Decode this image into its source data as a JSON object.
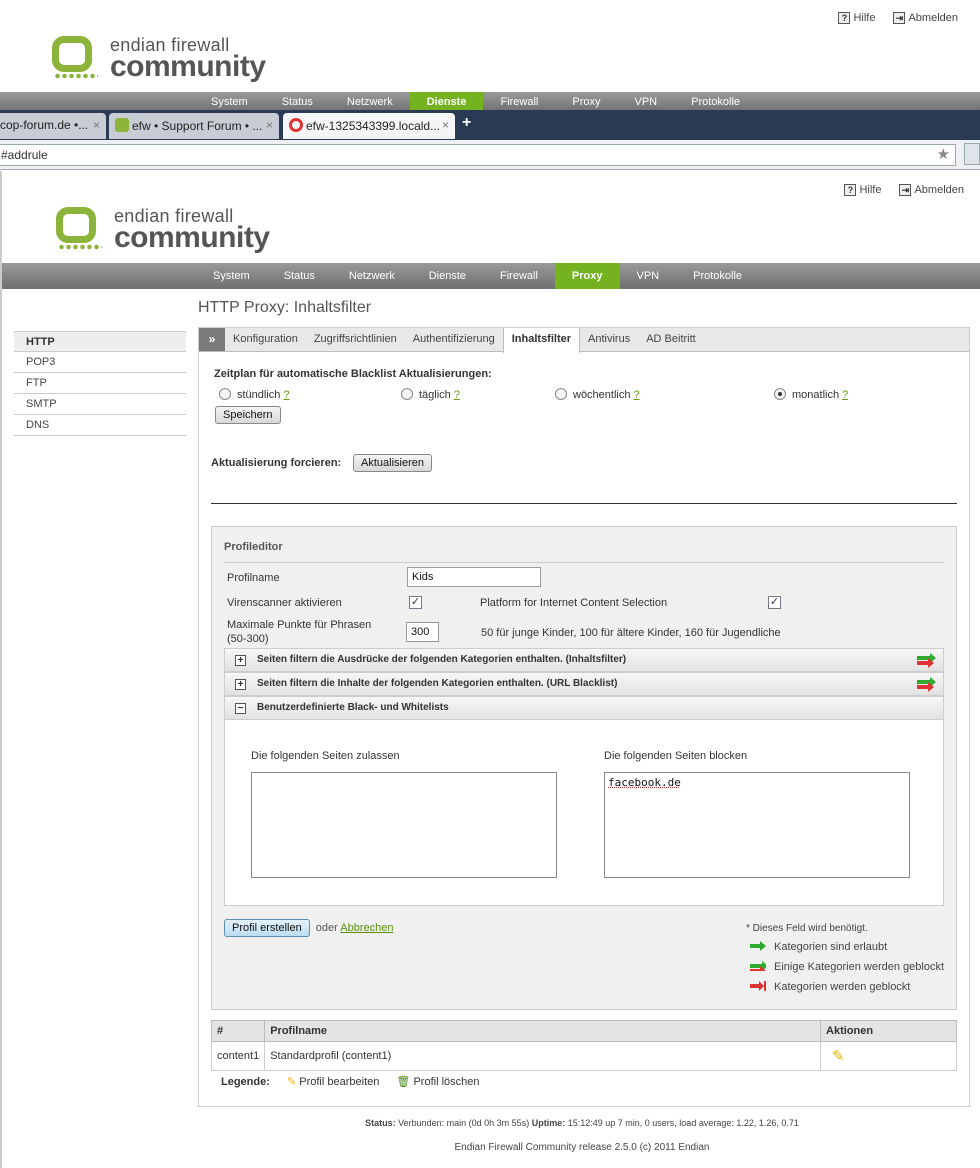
{
  "top_bg": {
    "help_label": "Hilfe",
    "logout_label": "Abmelden",
    "logo_line1": "endian firewall",
    "logo_line2": "community",
    "nav": [
      "System",
      "Status",
      "Netzwerk",
      "Dienste",
      "Firewall",
      "Proxy",
      "VPN",
      "Protokolle"
    ],
    "nav_active": "Dienste"
  },
  "browser": {
    "tabs": [
      {
        "title": "cop-forum.de •..."
      },
      {
        "title": "efw • Support Forum • ..."
      },
      {
        "title": "efw-1325343399.locald..."
      }
    ],
    "new_tab_label": "+",
    "url": "#addrule"
  },
  "header": {
    "help_label": "Hilfe",
    "logout_label": "Abmelden",
    "logo_line1": "endian firewall",
    "logo_line2": "community"
  },
  "nav": {
    "items": [
      "System",
      "Status",
      "Netzwerk",
      "Dienste",
      "Firewall",
      "Proxy",
      "VPN",
      "Protokolle"
    ],
    "active": "Proxy"
  },
  "sidebar": {
    "items": [
      "HTTP",
      "POP3",
      "FTP",
      "SMTP",
      "DNS"
    ],
    "active": "HTTP"
  },
  "page_title": "HTTP Proxy: Inhaltsfilter",
  "tabs": {
    "expander": "»",
    "items": [
      "Konfiguration",
      "Zugriffsrichtlinien",
      "Authentifizierung",
      "Inhaltsfilter",
      "Antivirus",
      "AD Beitritt"
    ],
    "active": "Inhaltsfilter"
  },
  "schedule": {
    "title": "Zeitplan für automatische Blacklist Aktualisierungen:",
    "options": [
      "stündlich",
      "täglich",
      "wöchentlich",
      "monatlich"
    ],
    "selected": "monatlich",
    "help_mark": "?",
    "save_label": "Speichern"
  },
  "force_update": {
    "label": "Aktualisierung forcieren:",
    "button": "Aktualisieren"
  },
  "profile_editor": {
    "title": "Profileditor",
    "profile_name_label": "Profilname",
    "profile_name_value": "Kids",
    "virus_label": "Virenscanner aktivieren",
    "virus_checked": true,
    "pics_label": "Platform for Internet Content Selection",
    "pics_checked": true,
    "max_points_label_1": "Maximale Punkte für Phrasen",
    "max_points_label_2": "(50-300)",
    "max_points_value": "300",
    "max_points_hint": "50 für junge Kinder, 100 für ältere Kinder, 160 für Jugendliche",
    "sections": [
      {
        "label": "Seiten filtern die Ausdrücke der folgenden Kategorien enthalten. (Inhaltsfilter)",
        "state": "+"
      },
      {
        "label": "Seiten filtern die Inhalte der folgenden Kategorien enthalten. (URL Blacklist)",
        "state": "+"
      },
      {
        "label": "Benutzerdefinierte Black- und Whitelists",
        "state": "−"
      }
    ],
    "allow_label": "Die folgenden Seiten zulassen",
    "allow_value": "",
    "block_label": "Die folgenden Seiten blocken",
    "block_value": "facebook.de",
    "create_button": "Profil erstellen",
    "or_text": "oder",
    "cancel_link": "Abbrechen",
    "required_note": "* Dieses Feld wird benötigt.",
    "legend": [
      {
        "icon": "arrow-green-icon",
        "text": "Kategorien sind erlaubt"
      },
      {
        "icon": "arrow-mixed-icon",
        "text": "Einige Kategorien werden geblockt"
      },
      {
        "icon": "arrow-red-icon",
        "text": "Kategorien werden geblockt"
      }
    ]
  },
  "profile_table": {
    "columns": [
      "#",
      "Profilname",
      "Aktionen"
    ],
    "rows": [
      {
        "id": "content1",
        "name": "Standardprofil (content1)"
      }
    ],
    "legend_label": "Legende:",
    "edit_label": "Profil bearbeiten",
    "delete_label": "Profil löschen"
  },
  "footer": {
    "status_label": "Status:",
    "status_text": "Verbunden: main (0d 0h 3m 55s)",
    "uptime_label": "Uptime:",
    "uptime_text": "15:12:49 up 7 min, 0 users, load average: 1.22, 1.26, 0.71",
    "release": "Endian Firewall Community release 2.5.0 (c) 2011 Endian"
  },
  "colors": {
    "accent_green": "#74b31f",
    "nav_gray": "#7b7b7b",
    "logo_green": "#8cb33a"
  }
}
